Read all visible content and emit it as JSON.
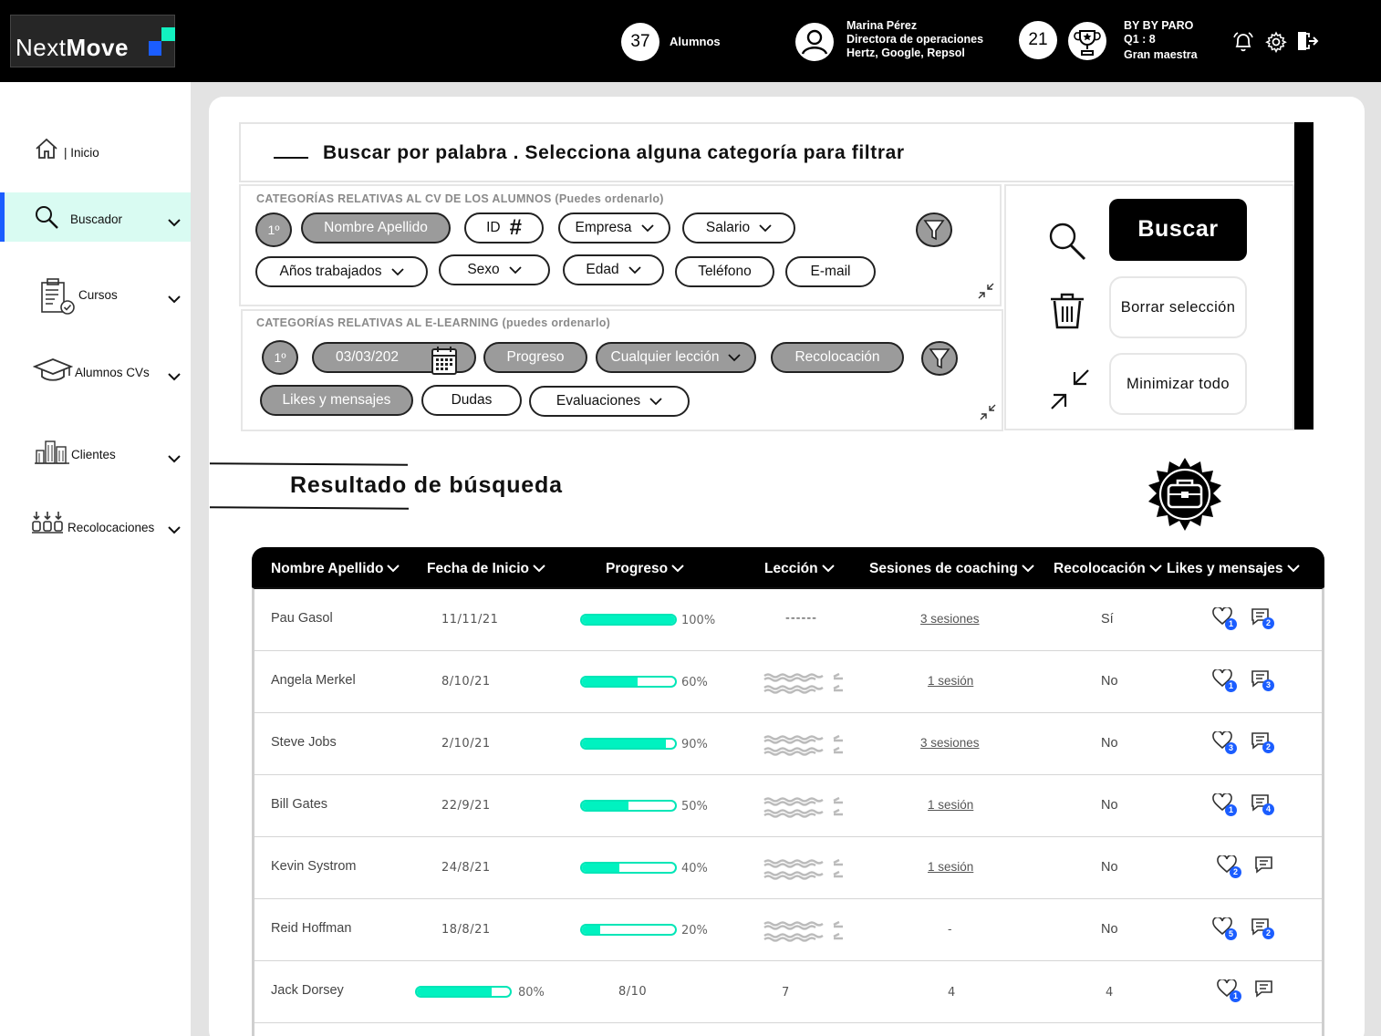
{
  "header": {
    "logo_light": "Next",
    "logo_bold": "Move",
    "alumnos_count": "37",
    "alumnos_label": "Alumnos",
    "user_name": "Marina Pérez",
    "user_role": "Directora de operaciones",
    "user_companies": "Hertz, Google, Repsol",
    "rank_number": "21",
    "rank_line1": "BY BY PARO",
    "rank_line2": "Q1 : 8",
    "rank_line3": "Gran maestra"
  },
  "sidebar": {
    "items": [
      {
        "label": "Inicio",
        "icon": "home-icon"
      },
      {
        "label": "Buscador",
        "icon": "search-icon"
      },
      {
        "label": "Cursos",
        "icon": "courses-icon"
      },
      {
        "label": "Alumnos CVs",
        "icon": "graduation-cap-icon"
      },
      {
        "label": "Clientes",
        "icon": "buildings-icon"
      },
      {
        "label": "Recolocaciones",
        "icon": "relocation-icon"
      }
    ]
  },
  "search": {
    "title": "Buscar por palabra . Selecciona alguna categoría para filtrar"
  },
  "cv_filters": {
    "title": "CATEGORÍAS RELATIVAS AL CV DE LOS ALUMNOS (Puedes ordenarlo)",
    "order": "1º",
    "chips": [
      "Nombre Apellido",
      "ID",
      "Empresa",
      "Salario",
      "Años trabajados",
      "Sexo",
      "Edad",
      "Teléfono",
      "E-mail"
    ],
    "id_symbol": "#"
  },
  "elearning_filters": {
    "title": "CATEGORÍAS RELATIVAS AL E-LEARNING  (puedes ordenarlo)",
    "order": "1º",
    "date": "03/03/202",
    "chips": [
      "Progreso",
      "Cualquier lección",
      "Recolocación",
      "Likes y mensajes",
      "Dudas",
      "Evaluaciones"
    ]
  },
  "actions": {
    "search_label": "Buscar",
    "clear_label": "Borrar selección",
    "minimize_label": "Minimizar todo"
  },
  "results": {
    "title": "Resultado de búsqueda",
    "columns": [
      "Nombre Apellido",
      "Fecha de Inicio",
      "Progreso",
      "Lección",
      "Sesiones de coaching",
      "Recolocación",
      "Likes y mensajes"
    ],
    "rows": [
      {
        "name": "Pau Gasol",
        "date": "11/11/21",
        "progress": 100,
        "progress_label": "100%",
        "lesson": "------",
        "sessions": "3 sesiones",
        "relocation": "Sí",
        "likes": "1",
        "messages": "2"
      },
      {
        "name": "Angela Merkel",
        "date": "8/10/21",
        "progress": 60,
        "progress_label": "60%",
        "lesson": "",
        "sessions": "1 sesión",
        "relocation": "No",
        "likes": "1",
        "messages": "3"
      },
      {
        "name": "Steve Jobs",
        "date": "2/10/21",
        "progress": 90,
        "progress_label": "90%",
        "lesson": "",
        "sessions": "3 sesiones",
        "relocation": "No",
        "likes": "3",
        "messages": "2"
      },
      {
        "name": "Bill Gates",
        "date": "22/9/21",
        "progress": 50,
        "progress_label": "50%",
        "lesson": "",
        "sessions": "1 sesión",
        "relocation": "No",
        "likes": "1",
        "messages": "4"
      },
      {
        "name": "Kevin Systrom",
        "date": "24/8/21",
        "progress": 40,
        "progress_label": "40%",
        "lesson": "",
        "sessions": "1 sesión",
        "relocation": "No",
        "likes": "2",
        "messages": ""
      },
      {
        "name": "Reid Hoffman",
        "date": "18/8/21",
        "progress": 20,
        "progress_label": "20%",
        "lesson": "",
        "sessions": "-",
        "relocation": "No",
        "likes": "5",
        "messages": "2"
      }
    ],
    "last_row": {
      "name": "Jack Dorsey",
      "progress": 80,
      "progress_label": "80%",
      "col3": "8/10",
      "col4": "7",
      "col5": "4",
      "col6": "4",
      "likes": "1"
    }
  }
}
